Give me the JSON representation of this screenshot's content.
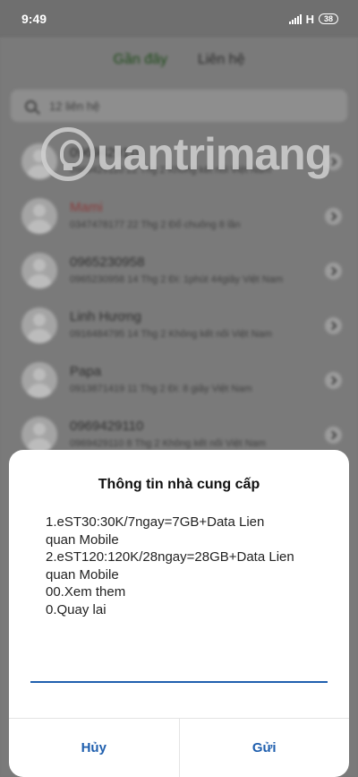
{
  "status_bar": {
    "time": "9:49",
    "network": "H",
    "battery": "38"
  },
  "background": {
    "tabs": {
      "recent": "Gần đây",
      "contacts": "Liên hệ"
    },
    "search": {
      "placeholder": "12 liên hệ"
    },
    "calls": [
      {
        "name": "0969429110",
        "detail": "0969429110 22 Thg 2 Không kết nối Việt Nam",
        "missed": false
      },
      {
        "name": "Mami",
        "detail": "0347478177 22 Thg 2 Đổ chuông 8 lần",
        "missed": true
      },
      {
        "name": "0965230958",
        "detail": "0965230958 14 Thg 2 Đi: 1phút 44giây Việt Nam",
        "missed": false
      },
      {
        "name": "Linh Hương",
        "detail": "0916484795 14 Thg 2 Không kết nối Việt Nam",
        "missed": false
      },
      {
        "name": "Papa",
        "detail": "0913871419 11 Thg 2 Đi: 8 giây Việt Nam",
        "missed": false
      },
      {
        "name": "0969429110",
        "detail": "0969429110 8 Thg 2 Không kết nối Việt Nam",
        "missed": false
      }
    ]
  },
  "watermark": {
    "text": "uantrimang"
  },
  "dialog": {
    "title": "Thông tin nhà cung cấp",
    "lines": [
      "1.eST30:30K/7ngay=7GB+Data Lien",
      "quan Mobile",
      "2.eST120:120K/28ngay=28GB+Data Lien",
      "quan Mobile",
      "00.Xem them",
      "0.Quay lai"
    ],
    "input_value": "",
    "cancel_label": "Hủy",
    "send_label": "Gửi"
  },
  "colors": {
    "accent": "#1f5fae",
    "dim_overlay": "#777777",
    "dialog_bg": "#ffffff"
  }
}
